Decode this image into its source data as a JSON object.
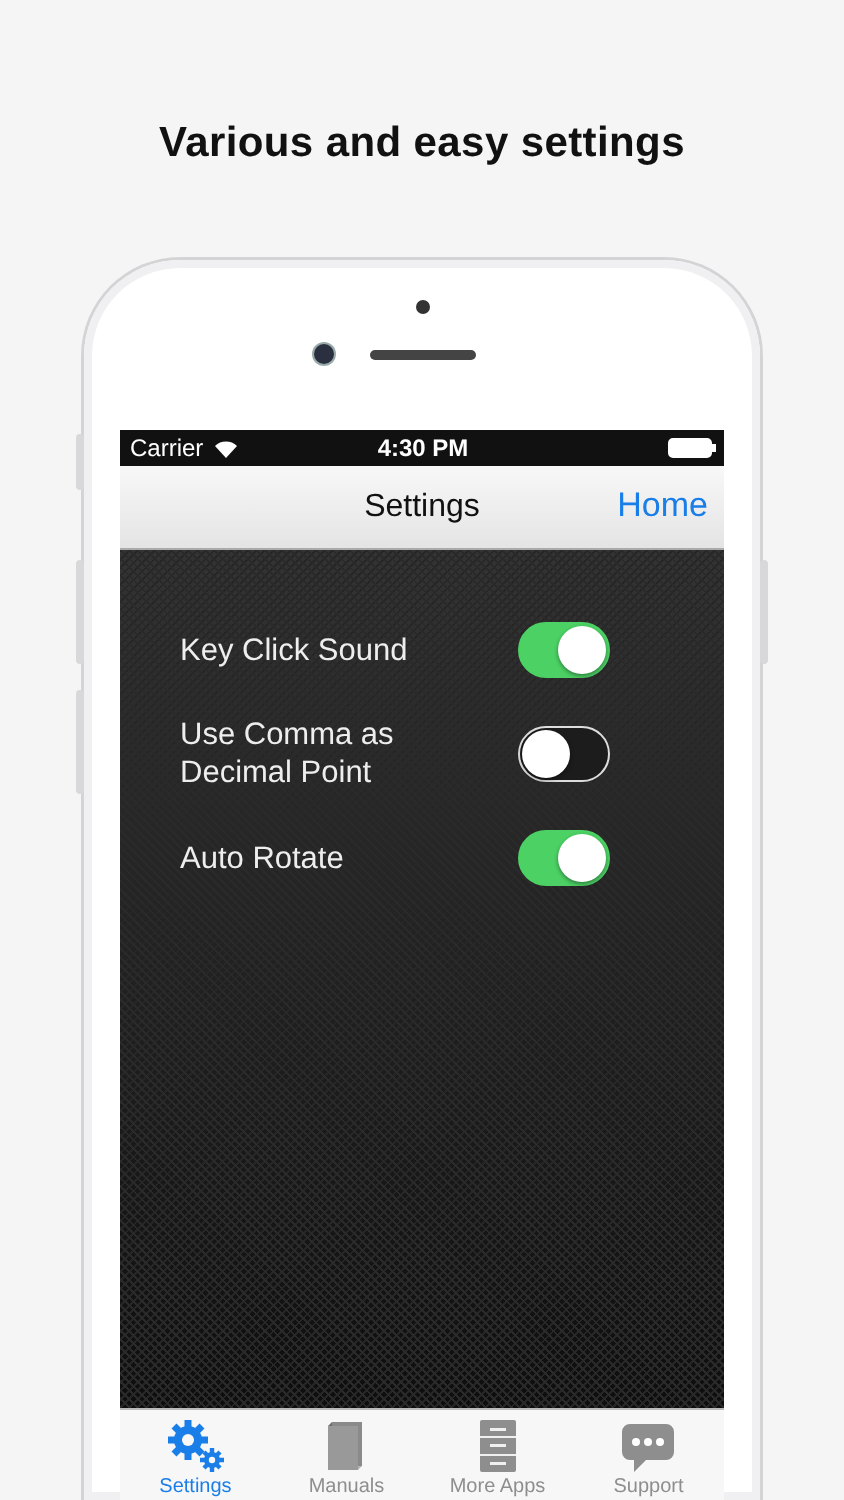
{
  "headline": "Various and easy settings",
  "status_bar": {
    "carrier": "Carrier",
    "time": "4:30 PM"
  },
  "nav_bar": {
    "title": "Settings",
    "right_button": "Home"
  },
  "settings": [
    {
      "label": "Key Click Sound",
      "on": true
    },
    {
      "label": "Use Comma as Decimal Point",
      "on": false
    },
    {
      "label": "Auto Rotate",
      "on": true
    }
  ],
  "tabs": [
    {
      "label": "Settings",
      "kind": "gears",
      "selected": true
    },
    {
      "label": "Manuals",
      "kind": "book",
      "selected": false
    },
    {
      "label": "More Apps",
      "kind": "cabinet",
      "selected": false
    },
    {
      "label": "Support",
      "kind": "chat",
      "selected": false
    }
  ]
}
